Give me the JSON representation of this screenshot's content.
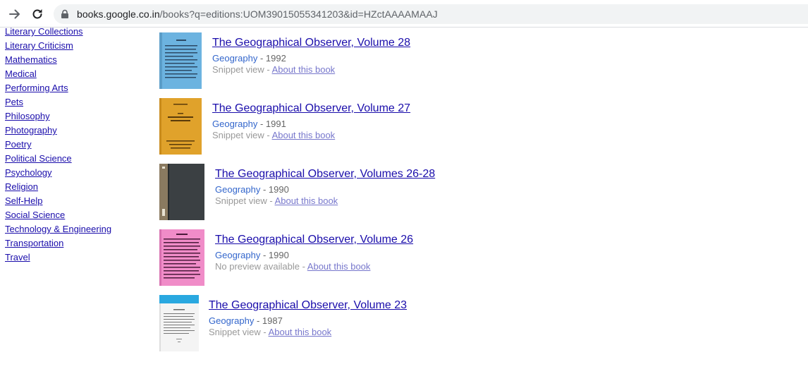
{
  "browser": {
    "url_host": "books.google.co.in",
    "url_rest": "/books?q=editions:UOM39015055341203&id=HZctAAAAMAAJ",
    "back_icon": "arrow-right-icon",
    "reload_icon": "reload-icon",
    "lock_icon": "lock-icon"
  },
  "sidebar": {
    "items": [
      "Literary Collections",
      "Literary Criticism",
      "Mathematics",
      "Medical",
      "Performing Arts",
      "Pets",
      "Philosophy",
      "Photography",
      "Poetry",
      "Political Science",
      "Psychology",
      "Religion",
      "Self-Help",
      "Social Science",
      "Technology & Engineering",
      "Transportation",
      "Travel"
    ]
  },
  "results": [
    {
      "title": "The Geographical Observer, Volume 28",
      "category": "Geography",
      "year": "1992",
      "preview": "Snippet view",
      "about": "About this book",
      "cover_color": "#6cb3e0"
    },
    {
      "title": "The Geographical Observer, Volume 27",
      "category": "Geography",
      "year": "1991",
      "preview": "Snippet view",
      "about": "About this book",
      "cover_color": "#e0a22b"
    },
    {
      "title": "The Geographical Observer, Volumes 26-28",
      "category": "Geography",
      "year": "1990",
      "preview": "Snippet view",
      "about": "About this book",
      "cover_color": "#3b4043"
    },
    {
      "title": "The Geographical Observer, Volume 26",
      "category": "Geography",
      "year": "1990",
      "preview": "No preview available",
      "about": "About this book",
      "cover_color": "#f08cc8"
    },
    {
      "title": "The Geographical Observer, Volume 23",
      "category": "Geography",
      "year": "1987",
      "preview": "Snippet view",
      "about": "About this book",
      "cover_color": "#f4f4f4"
    }
  ],
  "separator": " - "
}
